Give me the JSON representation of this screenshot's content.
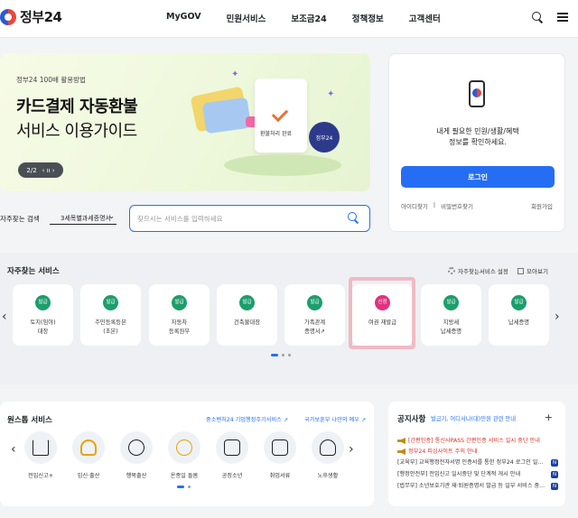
{
  "header": {
    "logo_text": "정부24",
    "nav": [
      "MyGOV",
      "민원서비스",
      "보조금24",
      "정책정보",
      "고객센터"
    ]
  },
  "banner": {
    "tag": "정부24 100배 활용방법",
    "title": "카드결제 자동환불",
    "subtitle": "서비스 이용가이드",
    "pager": "2/2",
    "pager_controls": "‹ ıı ›",
    "art_label": "환불처리 완료",
    "badge_text": "정부24"
  },
  "login": {
    "message_line1": "내게 필요한 민원/생활/혜택",
    "message_line2": "정보를 확인하세요.",
    "button": "로그인",
    "find_id": "아이디찾기",
    "find_pw": "비밀번호찾기",
    "signup": "회원가입"
  },
  "search": {
    "label": "자주찾는 검색",
    "select_value": "3세목별과세증명서",
    "placeholder": "찾으시는 서비스를 입력하세요"
  },
  "frequent": {
    "title": "자주찾는 서비스",
    "setting": "자주찾는서비스 설정",
    "more": "모아보기",
    "items": [
      {
        "badge": "발급",
        "label1": "토지(임야)",
        "label2": "대장",
        "badge_color": "#1c9e6c"
      },
      {
        "badge": "발급",
        "label1": "주민등록등본",
        "label2": "(초본)",
        "badge_color": "#1c9e6c"
      },
      {
        "badge": "발급",
        "label1": "자동차",
        "label2": "등록원부",
        "badge_color": "#1c9e6c"
      },
      {
        "badge": "발급",
        "label1": "건축물대장",
        "label2": "",
        "badge_color": "#1c9e6c"
      },
      {
        "badge": "발급",
        "label1": "가족관계",
        "label2": "증명서↗",
        "badge_color": "#1c9e6c"
      },
      {
        "badge": "신청",
        "label1": "여권 재발급",
        "label2": "",
        "badge_color": "#e0327f"
      },
      {
        "badge": "발급",
        "label1": "지방세",
        "label2": "납세증명",
        "badge_color": "#1c9e6c"
      },
      {
        "badge": "발급",
        "label1": "납세증명",
        "label2": "",
        "badge_color": "#1c9e6c"
      }
    ]
  },
  "onestop": {
    "title": "원스톱 서비스",
    "link1": "중소벤처24 기업행정주기서비스 ↗",
    "link2": "국가보훈부 나만의 예우 ↗",
    "items": [
      "전입신고+",
      "임신·출산",
      "행복출산",
      "온종일 돌봄",
      "공정소년",
      "취업서류",
      "노후생활"
    ]
  },
  "notices": {
    "title": "공지사항",
    "tag": "발급기, 어디서나(대)민원 관련 안내",
    "rows": [
      {
        "text": "[간편인증] 통신사PASS 간편인증 서비스 일시 중단 안내",
        "red": true,
        "icon": true,
        "badge": ""
      },
      {
        "text": "정부24 피싱사이트 주의 안내",
        "red": true,
        "icon": true,
        "badge": ""
      },
      {
        "text": "[교육부] 교육행정전자서명 인증서를 통한 정부24 로그인 일...",
        "red": false,
        "icon": false,
        "badge": "N"
      },
      {
        "text": "[행정안전부] 전입신고 일시중단 및 단계적 개시 안내",
        "red": false,
        "icon": false,
        "badge": "N"
      },
      {
        "text": "[법무부] 소년보호기관 재·퇴원증명서 발급 등 일부 서비스 중...",
        "red": false,
        "icon": false,
        "badge": "N"
      }
    ]
  }
}
